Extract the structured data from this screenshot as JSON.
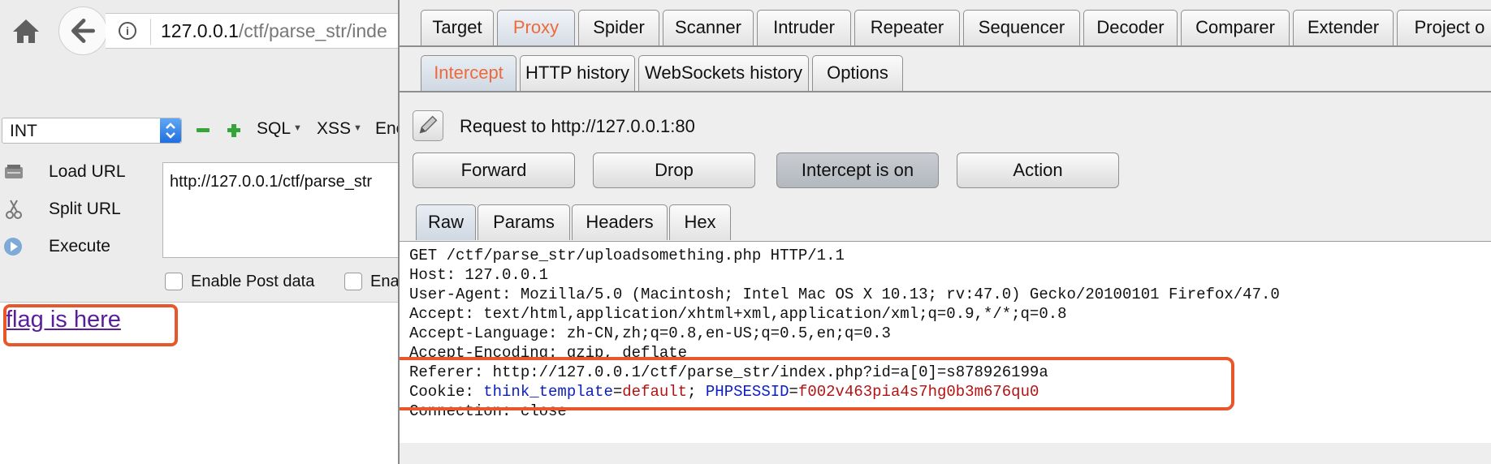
{
  "browser": {
    "url_host": "127.0.0.1",
    "url_path": "/ctf/parse_str/inde"
  },
  "hackbar": {
    "select_value": "INT",
    "menus": [
      "SQL",
      "XSS",
      "Enc"
    ],
    "buttons": {
      "load": "Load URL",
      "split": "Split URL",
      "execute": "Execute"
    },
    "url_value": "http://127.0.0.1/ctf/parse_str",
    "checkboxes": [
      "Enable Post data",
      "Enab"
    ]
  },
  "page": {
    "link_text": "flag is here"
  },
  "burp": {
    "main_tabs": [
      "Target",
      "Proxy",
      "Spider",
      "Scanner",
      "Intruder",
      "Repeater",
      "Sequencer",
      "Decoder",
      "Comparer",
      "Extender",
      "Project o"
    ],
    "proxy_tabs": [
      "Intercept",
      "HTTP history",
      "WebSockets history",
      "Options"
    ],
    "request_to": "Request to http://127.0.0.1:80",
    "actions": {
      "forward": "Forward",
      "drop": "Drop",
      "intercept": "Intercept is on",
      "action": "Action"
    },
    "view_tabs": [
      "Raw",
      "Params",
      "Headers",
      "Hex"
    ],
    "request": {
      "line1": "GET /ctf/parse_str/uploadsomething.php HTTP/1.1",
      "line2": "Host: 127.0.0.1",
      "line3": "User-Agent: Mozilla/5.0 (Macintosh; Intel Mac OS X 10.13; rv:47.0) Gecko/20100101 Firefox/47.0",
      "line4": "Accept: text/html,application/xhtml+xml,application/xml;q=0.9,*/*;q=0.8",
      "line5": "Accept-Language: zh-CN,zh;q=0.8,en-US;q=0.5,en;q=0.3",
      "line6": "Accept-Encoding: gzip, deflate",
      "line7": "Referer: http://127.0.0.1/ctf/parse_str/index.php?id=a[0]=s878926199a",
      "cookie_label": "Cookie: ",
      "cookie_k1": "think_template",
      "cookie_v1": "default",
      "cookie_k2": "PHPSESSID",
      "cookie_v2": "f002v463pia4s7hg0b3m676qu0",
      "line9": "Connection: close"
    }
  }
}
